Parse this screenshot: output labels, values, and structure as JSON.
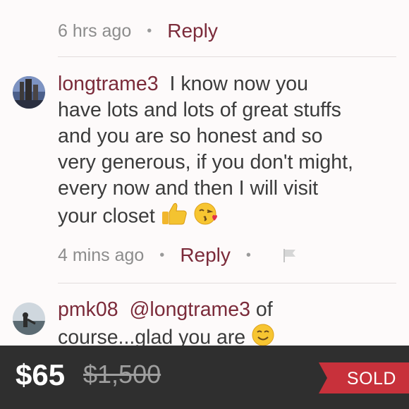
{
  "comment_prev": {
    "time": "6 hrs ago",
    "reply_label": "Reply"
  },
  "comment_1": {
    "username": "longtrame3",
    "text_line1": "I know now you",
    "text_lines": [
      "have lots and lots of great stuffs",
      "and you are so honest and so",
      "very generous, if you don't might,",
      "every now and then I will visit"
    ],
    "text_last": "your closet",
    "emojis": [
      "thumbs-up-icon",
      "kissing-face-icon"
    ],
    "time": "4 mins ago",
    "reply_label": "Reply"
  },
  "comment_2": {
    "username": "pmk08",
    "mention": "@longtrame3",
    "text_line1_tail": "of",
    "text_line2": "course...glad you are",
    "emojis": [
      "smiling-face-icon"
    ]
  },
  "listing": {
    "price": "$65",
    "original_price": "$1,500",
    "status": "SOLD"
  },
  "colors": {
    "accent": "#7b2b3a",
    "sold_ribbon": "#c8313b",
    "bar_bg": "#2f2f2f"
  }
}
